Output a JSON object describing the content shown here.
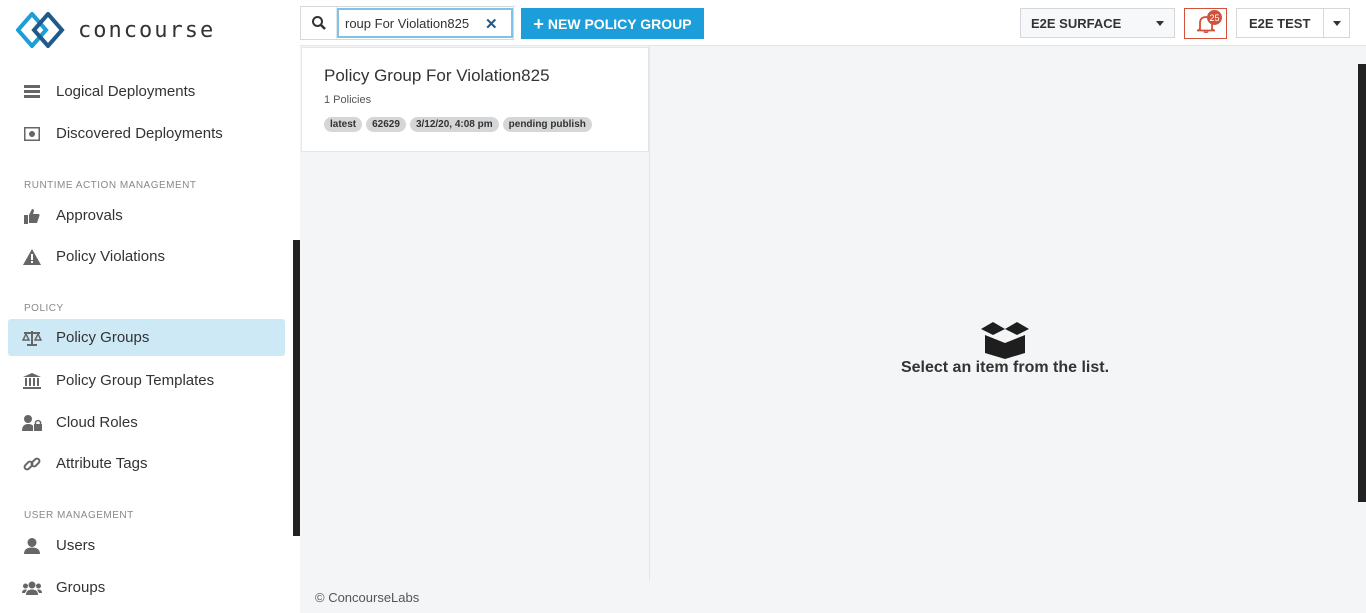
{
  "brand": {
    "name": "concourse"
  },
  "sidebar": {
    "items": [
      {
        "label": "Logical Deployments",
        "icon": "server-icon"
      },
      {
        "label": "Discovered Deployments",
        "icon": "radar-icon"
      },
      {
        "label": "Approvals",
        "icon": "thumbs-up-icon"
      },
      {
        "label": "Policy Violations",
        "icon": "warning-icon"
      },
      {
        "label": "Policy Groups",
        "icon": "scale-icon"
      },
      {
        "label": "Policy Group Templates",
        "icon": "bank-icon"
      },
      {
        "label": "Cloud Roles",
        "icon": "user-lock-icon"
      },
      {
        "label": "Attribute Tags",
        "icon": "link-icon"
      },
      {
        "label": "Users",
        "icon": "user-icon"
      },
      {
        "label": "Groups",
        "icon": "users-icon"
      }
    ],
    "sections": {
      "runtime": "RUNTIME ACTION MANAGEMENT",
      "policy": "POLICY",
      "user_mgmt": "USER MANAGEMENT"
    }
  },
  "topbar": {
    "search_value": "roup For Violation825",
    "new_button": "NEW POLICY GROUP",
    "env": "E2E SURFACE",
    "notification_count": "25",
    "user": "E2E TEST"
  },
  "list": {
    "items": [
      {
        "title": "Policy Group For Violation825",
        "subtitle": "1 Policies",
        "tags": [
          "latest",
          "62629",
          "3/12/20, 4:08 pm",
          "pending publish"
        ]
      }
    ]
  },
  "detail": {
    "empty_message": "Select an item from the list."
  },
  "footer": {
    "copyright": "© ConcourseLabs"
  },
  "colors": {
    "accent": "#1b9ed9",
    "active_bg": "#cde9f5",
    "alert": "#d2513b"
  }
}
